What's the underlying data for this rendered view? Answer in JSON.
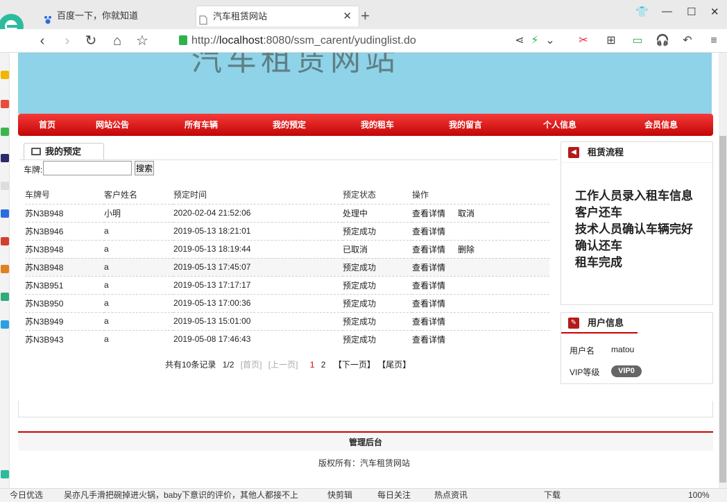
{
  "browser": {
    "tabs": [
      {
        "label": "百度一下，你就知道"
      },
      {
        "label": "汽车租赁网站"
      }
    ],
    "url_prefix": "http://",
    "url_host": "localhost",
    "url_rest": ":8080/ssm_carent/yudinglist.do"
  },
  "site": {
    "banner_title": "汽车租赁网站",
    "nav": [
      "首页",
      "网站公告",
      "所有车辆",
      "我的预定",
      "我的租车",
      "我的留言",
      "个人信息",
      "会员信息"
    ]
  },
  "main": {
    "tab_title": "我的预定",
    "search_label": "车牌:",
    "search_value": "",
    "search_button": "搜索",
    "columns": [
      "车牌号",
      "客户姓名",
      "预定时间",
      "预定状态",
      "操作"
    ],
    "rows": [
      {
        "plate": "苏N3B948",
        "name": "小明",
        "time": "2020-02-04 21:52:06",
        "status": "处理中",
        "action1": "查看详情",
        "action2": "取消"
      },
      {
        "plate": "苏N3B946",
        "name": "a",
        "time": "2019-05-13 18:21:01",
        "status": "预定成功",
        "action1": "查看详情",
        "action2": ""
      },
      {
        "plate": "苏N3B948",
        "name": "a",
        "time": "2019-05-13 18:19:44",
        "status": "已取消",
        "action1": "查看详情",
        "action2": "删除"
      },
      {
        "plate": "苏N3B948",
        "name": "a",
        "time": "2019-05-13 17:45:07",
        "status": "预定成功",
        "action1": "查看详情",
        "action2": ""
      },
      {
        "plate": "苏N3B951",
        "name": "a",
        "time": "2019-05-13 17:17:17",
        "status": "预定成功",
        "action1": "查看详情",
        "action2": ""
      },
      {
        "plate": "苏N3B950",
        "name": "a",
        "time": "2019-05-13 17:00:36",
        "status": "预定成功",
        "action1": "查看详情",
        "action2": ""
      },
      {
        "plate": "苏N3B949",
        "name": "a",
        "time": "2019-05-13 15:01:00",
        "status": "预定成功",
        "action1": "查看详情",
        "action2": ""
      },
      {
        "plate": "苏N3B943",
        "name": "a",
        "time": "2019-05-08 17:46:43",
        "status": "预定成功",
        "action1": "查看详情",
        "action2": ""
      }
    ],
    "pager": {
      "summary": "共有10条记录",
      "page_info": "1/2",
      "first": "[首页]",
      "prev": "[上一页]",
      "current": "1",
      "page2": "2",
      "next": "【下一页】",
      "last": "【尾页】"
    }
  },
  "sidebar": {
    "process_title": "租赁流程",
    "process_steps": [
      "工作人员录入租车信息",
      "客户还车",
      "技术人员确认车辆完好",
      "确认还车",
      "租车完成"
    ],
    "user_title": "用户信息",
    "username_label": "用户名",
    "username": "matou",
    "vip_label": "VIP等级",
    "vip_value": "VIP0"
  },
  "footer": {
    "admin_link": "管理后台",
    "copyright": "版权所有：汽车租赁网站"
  },
  "statusbar": {
    "items": [
      "今日优选",
      "吴亦凡手滑把碗掉进火锅，baby下意识的评价，其他人都接不上",
      "快剪辑",
      "每日关注",
      "热点资讯",
      "下载",
      "100%"
    ]
  },
  "colors": {
    "nav_red": "#d81010",
    "banner": "#8fd3e8",
    "accent": "#b51a1a"
  }
}
